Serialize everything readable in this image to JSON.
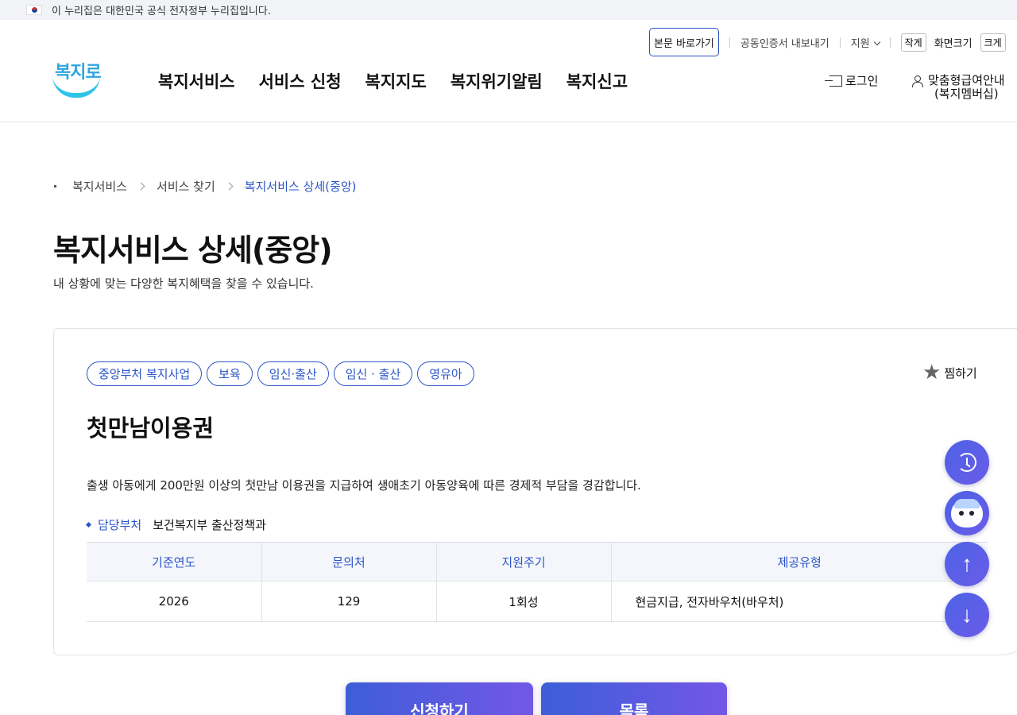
{
  "gov_bar": {
    "text": "이 누리집은 대한민국 공식 전자정부 누리집입니다."
  },
  "utility": {
    "skip_label": "본문 바로가기",
    "cert_label": "공동인증서 내보내기",
    "lang_label": "지원",
    "font_small": "작게",
    "font_label": "화면크기",
    "font_large": "크게"
  },
  "logo": {
    "text": "복지로"
  },
  "gnb": [
    "복지서비스",
    "서비스 신청",
    "복지지도",
    "복지위기알림",
    "복지신고"
  ],
  "header_right": {
    "login": "로그인",
    "member_line1": "맞춤형급여안내",
    "member_line2": "(복지멤버십)"
  },
  "breadcrumb": [
    "복지서비스",
    "서비스 찾기",
    "복지서비스 상세(중앙)"
  ],
  "page": {
    "title": "복지서비스 상세(중앙)",
    "subtitle": "내 상황에 맞는 다양한 복지혜택을 찾을 수 있습니다."
  },
  "service": {
    "tags": [
      "중앙부처 복지사업",
      "보육",
      "임신·출산",
      "임신 · 출산",
      "영유아"
    ],
    "favorite_label": "찜하기",
    "title": "첫만남이용권",
    "description": "출생 아동에게 200만원 이상의 첫만남 이용권을 지급하여 생애초기 아동양육에 따른 경제적 부담을 경감합니다.",
    "dept_label": "담당부처",
    "dept_value": "보건복지부 출산정책과",
    "table": {
      "headers": [
        "기준연도",
        "문의처",
        "지원주기",
        "제공유형"
      ],
      "row": [
        "2026",
        "129",
        "1회성",
        "현금지급, 전자바우처(바우처)"
      ]
    }
  },
  "floating": [
    "history-icon",
    "chatbot-icon",
    "arrow-up-icon",
    "arrow-down-icon"
  ],
  "actions": {
    "apply": "신청하기",
    "list": "목록"
  },
  "colors": {
    "accent": "#2b55c8",
    "button_start": "#3d5ed8",
    "button_end": "#7357e6"
  }
}
